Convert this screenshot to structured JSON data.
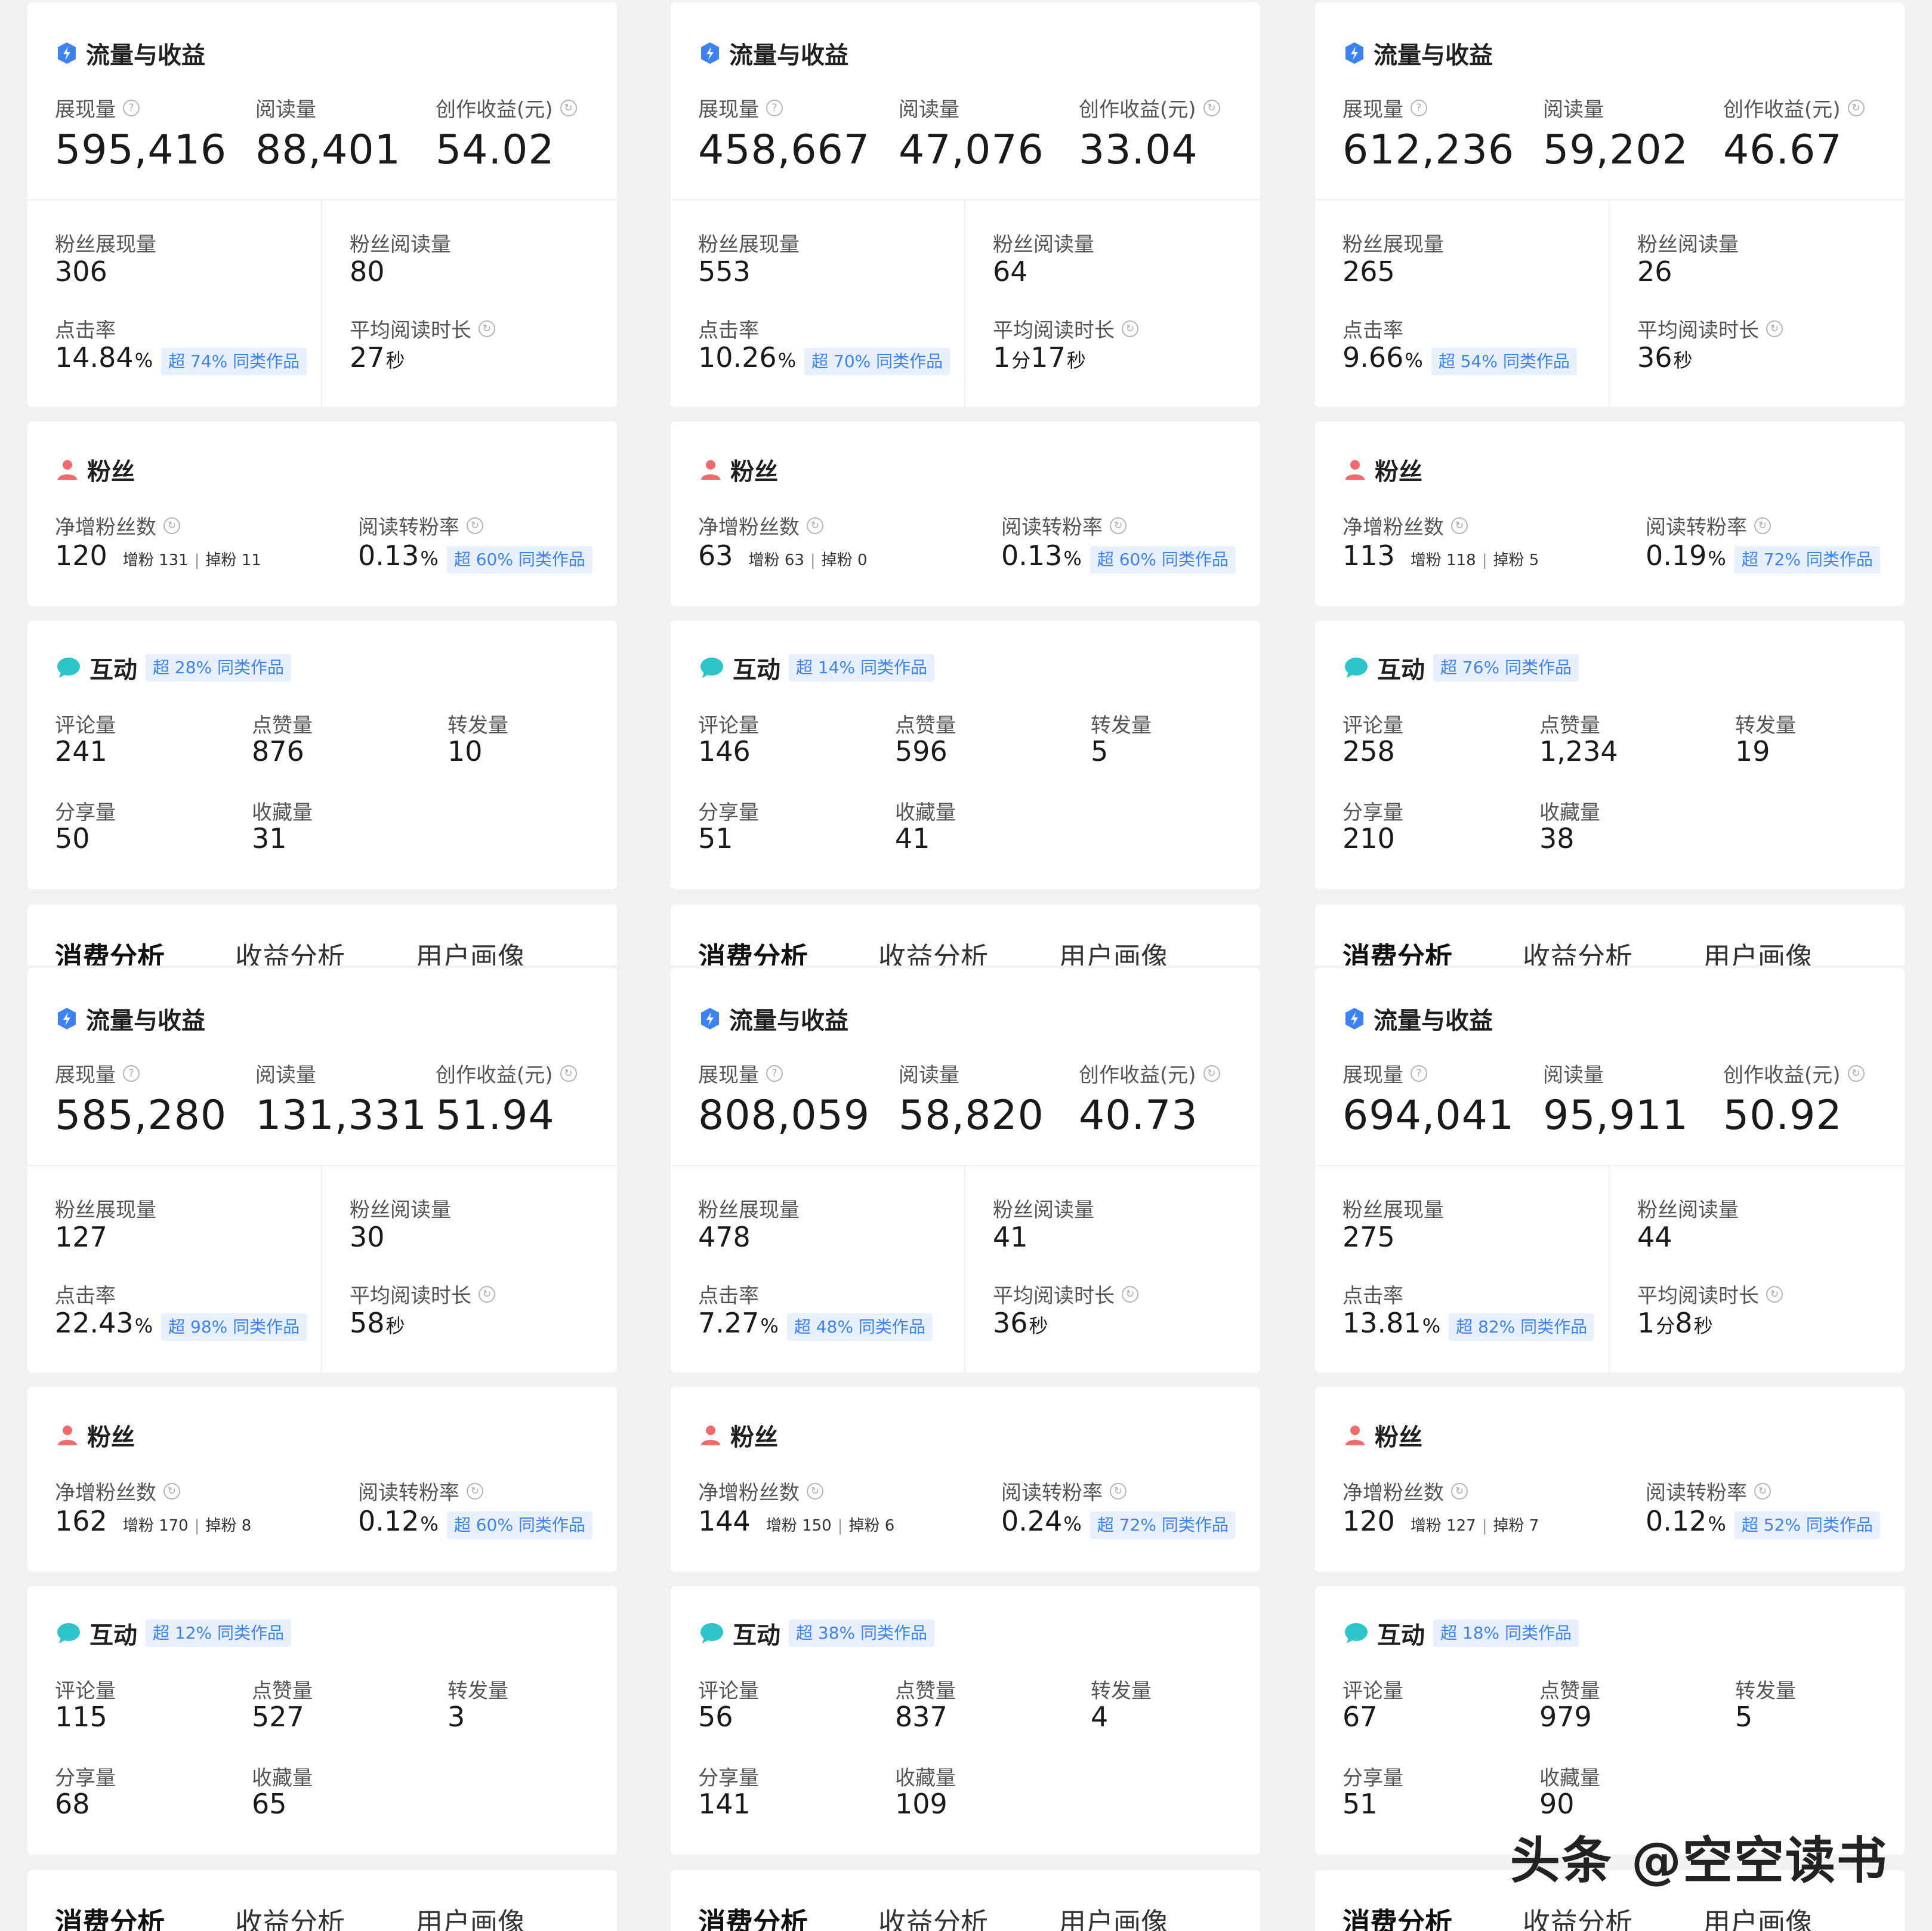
{
  "labels": {
    "traffic_title": "流量与收益",
    "impressions": "展现量",
    "reads": "阅读量",
    "earnings": "创作收益(元)",
    "fan_impressions": "粉丝展现量",
    "fan_reads": "粉丝阅读量",
    "ctr": "点击率",
    "avg_read_time": "平均阅读时长",
    "fans_title": "粉丝",
    "net_fans": "净增粉丝数",
    "read_to_fan": "阅读转粉率",
    "gain": "增粉",
    "loss": "掉粉",
    "interaction_title": "互动",
    "comments": "评论量",
    "likes": "点赞量",
    "reposts": "转发量",
    "shares": "分享量",
    "favorites": "收藏量",
    "percent_unit": "%",
    "second_unit": "秒",
    "minute_unit": "分"
  },
  "tabs": [
    "消费分析",
    "收益分析",
    "用户画像"
  ],
  "icons": {
    "traffic": "lightning-icon",
    "fans": "person-icon",
    "interaction": "chat-bubble-icon",
    "help": "question-circle-icon",
    "info": "clock-circle-icon"
  },
  "colors": {
    "accent_blue": "#3b82f6",
    "badge_bg": "#e8f0fd",
    "fans_red": "#f26a6a",
    "interaction_teal": "#2cc5c9"
  },
  "watermark": "头条 @空空读书",
  "reports": [
    {
      "impressions": "595,416",
      "reads": "88,401",
      "earnings": "54.02",
      "fan_impressions": "306",
      "fan_reads": "80",
      "ctr": "14.84",
      "ctr_badge": "超 74% 同类作品",
      "avg_time_min": "",
      "avg_time_sec": "27",
      "net_fans": "120",
      "gain": "131",
      "loss": "11",
      "read_to_fan": "0.13",
      "read_to_fan_badge": "超 60% 同类作品",
      "interaction_badge": "超 28% 同类作品",
      "comments": "241",
      "likes": "876",
      "reposts": "10",
      "shares": "50",
      "favorites": "31"
    },
    {
      "impressions": "458,667",
      "reads": "47,076",
      "earnings": "33.04",
      "fan_impressions": "553",
      "fan_reads": "64",
      "ctr": "10.26",
      "ctr_badge": "超 70% 同类作品",
      "avg_time_min": "1",
      "avg_time_sec": "17",
      "net_fans": "63",
      "gain": "63",
      "loss": "0",
      "read_to_fan": "0.13",
      "read_to_fan_badge": "超 60% 同类作品",
      "interaction_badge": "超 14% 同类作品",
      "comments": "146",
      "likes": "596",
      "reposts": "5",
      "shares": "51",
      "favorites": "41"
    },
    {
      "impressions": "612,236",
      "reads": "59,202",
      "earnings": "46.67",
      "fan_impressions": "265",
      "fan_reads": "26",
      "ctr": "9.66",
      "ctr_badge": "超 54% 同类作品",
      "avg_time_min": "",
      "avg_time_sec": "36",
      "net_fans": "113",
      "gain": "118",
      "loss": "5",
      "read_to_fan": "0.19",
      "read_to_fan_badge": "超 72% 同类作品",
      "interaction_badge": "超 76% 同类作品",
      "comments": "258",
      "likes": "1,234",
      "reposts": "19",
      "shares": "210",
      "favorites": "38"
    },
    {
      "impressions": "585,280",
      "reads": "131,331",
      "earnings": "51.94",
      "fan_impressions": "127",
      "fan_reads": "30",
      "ctr": "22.43",
      "ctr_badge": "超 98% 同类作品",
      "avg_time_min": "",
      "avg_time_sec": "58",
      "net_fans": "162",
      "gain": "170",
      "loss": "8",
      "read_to_fan": "0.12",
      "read_to_fan_badge": "超 60% 同类作品",
      "interaction_badge": "超 12% 同类作品",
      "comments": "115",
      "likes": "527",
      "reposts": "3",
      "shares": "68",
      "favorites": "65"
    },
    {
      "impressions": "808,059",
      "reads": "58,820",
      "earnings": "40.73",
      "fan_impressions": "478",
      "fan_reads": "41",
      "ctr": "7.27",
      "ctr_badge": "超 48% 同类作品",
      "avg_time_min": "",
      "avg_time_sec": "36",
      "net_fans": "144",
      "gain": "150",
      "loss": "6",
      "read_to_fan": "0.24",
      "read_to_fan_badge": "超 72% 同类作品",
      "interaction_badge": "超 38% 同类作品",
      "comments": "56",
      "likes": "837",
      "reposts": "4",
      "shares": "141",
      "favorites": "109"
    },
    {
      "impressions": "694,041",
      "reads": "95,911",
      "earnings": "50.92",
      "fan_impressions": "275",
      "fan_reads": "44",
      "ctr": "13.81",
      "ctr_badge": "超 82% 同类作品",
      "avg_time_min": "1",
      "avg_time_sec": "8",
      "net_fans": "120",
      "gain": "127",
      "loss": "7",
      "read_to_fan": "0.12",
      "read_to_fan_badge": "超 52% 同类作品",
      "interaction_badge": "超 18% 同类作品",
      "comments": "67",
      "likes": "979",
      "reposts": "5",
      "shares": "51",
      "favorites": "90"
    }
  ]
}
